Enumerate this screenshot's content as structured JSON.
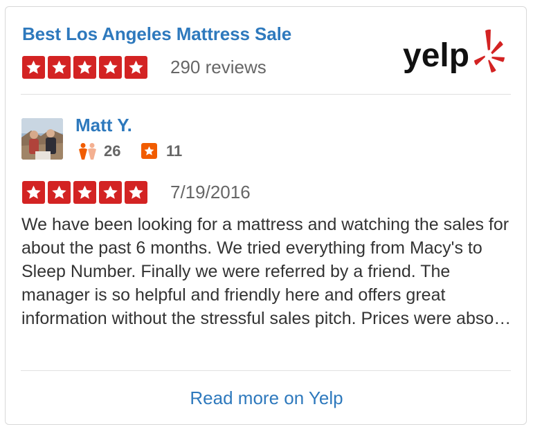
{
  "business": {
    "name": "Best Los Angeles Mattress Sale",
    "rating": 5,
    "review_count_text": "290 reviews"
  },
  "logo": {
    "text": "yelp",
    "icon": "yelp-burst-icon"
  },
  "review": {
    "user_name": "Matt Y.",
    "friends_count": "26",
    "reviews_count": "11",
    "rating": 5,
    "date": "7/19/2016",
    "text": "We have been looking for a mattress and watching the sales for about the past 6 months. We tried everything from Macy's to Sleep Number. Finally we were referred by a friend. The manager is so helpful and friendly here and offers great information without the stressful sales pitch. Prices were abso…"
  },
  "footer": {
    "read_more_label": "Read more on Yelp"
  },
  "colors": {
    "link": "#2e79bd",
    "star": "#d32323",
    "review_badge": "#f15c00",
    "friend_icon": "#f15c00"
  }
}
